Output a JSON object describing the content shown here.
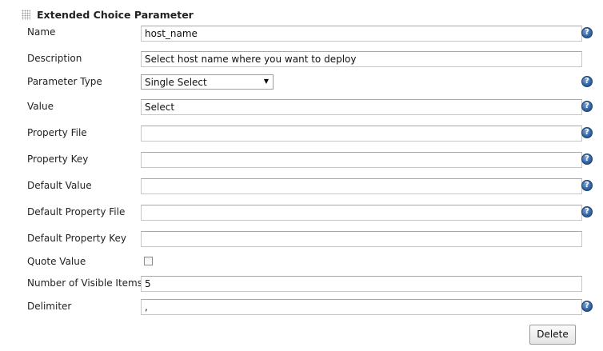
{
  "section": {
    "title": "Extended Choice Parameter",
    "grip_icon": "drag-handle-icon"
  },
  "fields": {
    "name": {
      "label": "Name",
      "value": "host_name"
    },
    "description": {
      "label": "Description",
      "value": "Select host name where you want to deploy"
    },
    "parameter_type": {
      "label": "Parameter Type",
      "value": "Single Select"
    },
    "value": {
      "label": "Value",
      "value": "Select"
    },
    "property_file": {
      "label": "Property File",
      "value": ""
    },
    "property_key": {
      "label": "Property Key",
      "value": ""
    },
    "default_value": {
      "label": "Default Value",
      "value": ""
    },
    "default_property_file": {
      "label": "Default Property File",
      "value": ""
    },
    "default_property_key": {
      "label": "Default Property Key",
      "value": ""
    },
    "quote_value": {
      "label": "Quote Value",
      "checked": false
    },
    "visible_items": {
      "label": "Number of Visible Items",
      "value": "5"
    },
    "delimiter": {
      "label": "Delimiter",
      "value": ","
    }
  },
  "help_glyph": "?",
  "delete_button": {
    "label": "Delete"
  },
  "colors": {
    "help_icon": "#2f62a1",
    "border": "#c6c6c6"
  }
}
